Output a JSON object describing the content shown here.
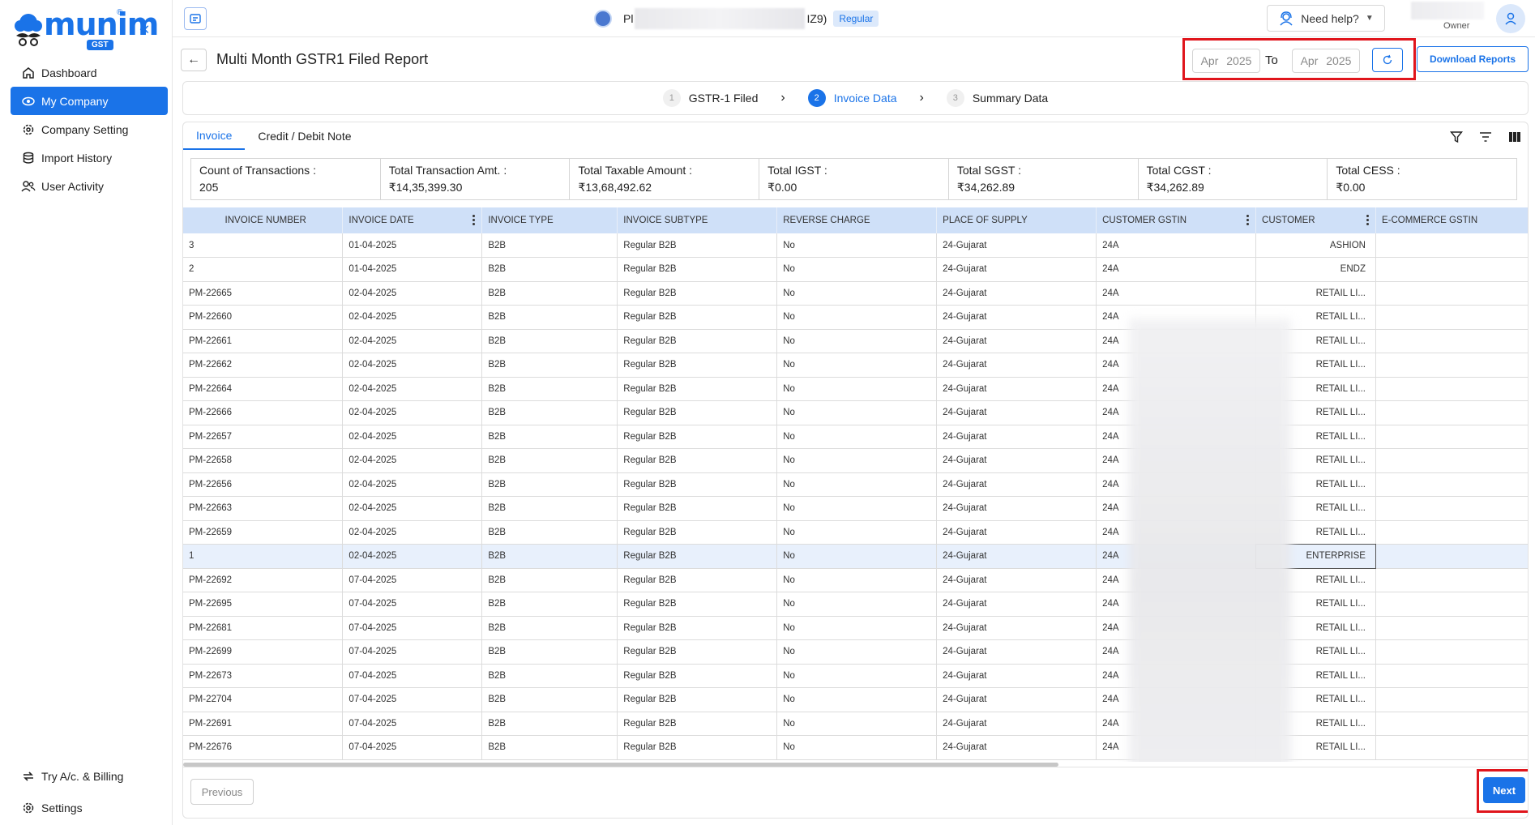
{
  "brand": {
    "name": "munim",
    "reg": "®",
    "tag": "GST"
  },
  "sidebar": {
    "items": [
      {
        "label": "Dashboard",
        "icon": "home-icon"
      },
      {
        "label": "My Company",
        "icon": "eye-icon",
        "active": true
      },
      {
        "label": "Company Setting",
        "icon": "gear-icon"
      },
      {
        "label": "Import History",
        "icon": "database-icon"
      },
      {
        "label": "User Activity",
        "icon": "users-icon"
      }
    ],
    "bottom": [
      {
        "label": "Try A/c. & Billing",
        "icon": "switch-icon"
      },
      {
        "label": "Settings",
        "icon": "gear-icon"
      }
    ]
  },
  "topbar": {
    "company_prefix": "Pl",
    "company_suffix": "IZ9)",
    "badge": "Regular",
    "help": "Need help?",
    "role": "Owner"
  },
  "page": {
    "title": "Multi Month GSTR1 Filed Report",
    "from_month": "Apr 2025",
    "to_label": "To",
    "to_month": "Apr 2025",
    "download": "Download Reports"
  },
  "steps": [
    {
      "num": "1",
      "label": "GSTR-1 Filed"
    },
    {
      "num": "2",
      "label": "Invoice Data",
      "active": true
    },
    {
      "num": "3",
      "label": "Summary Data"
    }
  ],
  "tabs": [
    "Invoice",
    "Credit / Debit Note"
  ],
  "summary": [
    {
      "label": "Count of Transactions :",
      "value": "205"
    },
    {
      "label": "Total Transaction Amt. :",
      "value": "₹14,35,399.30"
    },
    {
      "label": "Total Taxable Amount :",
      "value": "₹13,68,492.62"
    },
    {
      "label": "Total IGST :",
      "value": "₹0.00"
    },
    {
      "label": "Total SGST :",
      "value": "₹34,262.89"
    },
    {
      "label": "Total CGST :",
      "value": "₹34,262.89"
    },
    {
      "label": "Total CESS :",
      "value": "₹0.00"
    }
  ],
  "table": {
    "columns": [
      "INVOICE NUMBER",
      "INVOICE DATE",
      "INVOICE TYPE",
      "INVOICE SUBTYPE",
      "REVERSE CHARGE",
      "PLACE OF SUPPLY",
      "CUSTOMER GSTIN",
      "CUSTOMER",
      "E-COMMERCE GSTIN"
    ],
    "rows": [
      [
        "3",
        "01-04-2025",
        "B2B",
        "Regular B2B",
        "No",
        "24-Gujarat",
        "24A",
        "ASHION",
        ""
      ],
      [
        "2",
        "01-04-2025",
        "B2B",
        "Regular B2B",
        "No",
        "24-Gujarat",
        "24A",
        "ENDZ",
        ""
      ],
      [
        "PM-22665",
        "02-04-2025",
        "B2B",
        "Regular B2B",
        "No",
        "24-Gujarat",
        "24A",
        "RETAIL LI...",
        ""
      ],
      [
        "PM-22660",
        "02-04-2025",
        "B2B",
        "Regular B2B",
        "No",
        "24-Gujarat",
        "24A",
        "RETAIL LI...",
        ""
      ],
      [
        "PM-22661",
        "02-04-2025",
        "B2B",
        "Regular B2B",
        "No",
        "24-Gujarat",
        "24A",
        "RETAIL LI...",
        ""
      ],
      [
        "PM-22662",
        "02-04-2025",
        "B2B",
        "Regular B2B",
        "No",
        "24-Gujarat",
        "24A",
        "RETAIL LI...",
        ""
      ],
      [
        "PM-22664",
        "02-04-2025",
        "B2B",
        "Regular B2B",
        "No",
        "24-Gujarat",
        "24A",
        "RETAIL LI...",
        ""
      ],
      [
        "PM-22666",
        "02-04-2025",
        "B2B",
        "Regular B2B",
        "No",
        "24-Gujarat",
        "24A",
        "RETAIL LI...",
        ""
      ],
      [
        "PM-22657",
        "02-04-2025",
        "B2B",
        "Regular B2B",
        "No",
        "24-Gujarat",
        "24A",
        "RETAIL LI...",
        ""
      ],
      [
        "PM-22658",
        "02-04-2025",
        "B2B",
        "Regular B2B",
        "No",
        "24-Gujarat",
        "24A",
        "RETAIL LI...",
        ""
      ],
      [
        "PM-22656",
        "02-04-2025",
        "B2B",
        "Regular B2B",
        "No",
        "24-Gujarat",
        "24A",
        "RETAIL LI...",
        ""
      ],
      [
        "PM-22663",
        "02-04-2025",
        "B2B",
        "Regular B2B",
        "No",
        "24-Gujarat",
        "24A",
        "RETAIL LI...",
        ""
      ],
      [
        "PM-22659",
        "02-04-2025",
        "B2B",
        "Regular B2B",
        "No",
        "24-Gujarat",
        "24A",
        "RETAIL LI...",
        ""
      ],
      [
        "1",
        "02-04-2025",
        "B2B",
        "Regular B2B",
        "No",
        "24-Gujarat",
        "24A",
        "ENTERPRISE",
        ""
      ],
      [
        "PM-22692",
        "07-04-2025",
        "B2B",
        "Regular B2B",
        "No",
        "24-Gujarat",
        "24A",
        "RETAIL LI...",
        ""
      ],
      [
        "PM-22695",
        "07-04-2025",
        "B2B",
        "Regular B2B",
        "No",
        "24-Gujarat",
        "24A",
        "RETAIL LI...",
        ""
      ],
      [
        "PM-22681",
        "07-04-2025",
        "B2B",
        "Regular B2B",
        "No",
        "24-Gujarat",
        "24A",
        "RETAIL LI...",
        ""
      ],
      [
        "PM-22699",
        "07-04-2025",
        "B2B",
        "Regular B2B",
        "No",
        "24-Gujarat",
        "24A",
        "RETAIL LI...",
        ""
      ],
      [
        "PM-22673",
        "07-04-2025",
        "B2B",
        "Regular B2B",
        "No",
        "24-Gujarat",
        "24A",
        "RETAIL LI...",
        ""
      ],
      [
        "PM-22704",
        "07-04-2025",
        "B2B",
        "Regular B2B",
        "No",
        "24-Gujarat",
        "24A",
        "RETAIL LI...",
        ""
      ],
      [
        "PM-22691",
        "07-04-2025",
        "B2B",
        "Regular B2B",
        "No",
        "24-Gujarat",
        "24A",
        "RETAIL LI...",
        ""
      ],
      [
        "PM-22676",
        "07-04-2025",
        "B2B",
        "Regular B2B",
        "No",
        "24-Gujarat",
        "24A",
        "RETAIL LI...",
        ""
      ]
    ],
    "selected_row": 13
  },
  "footer": {
    "previous": "Previous",
    "next": "Next"
  },
  "colors": {
    "accent": "#1a73e8",
    "highlight": "#e0151c",
    "header": "#cfe0f8"
  }
}
